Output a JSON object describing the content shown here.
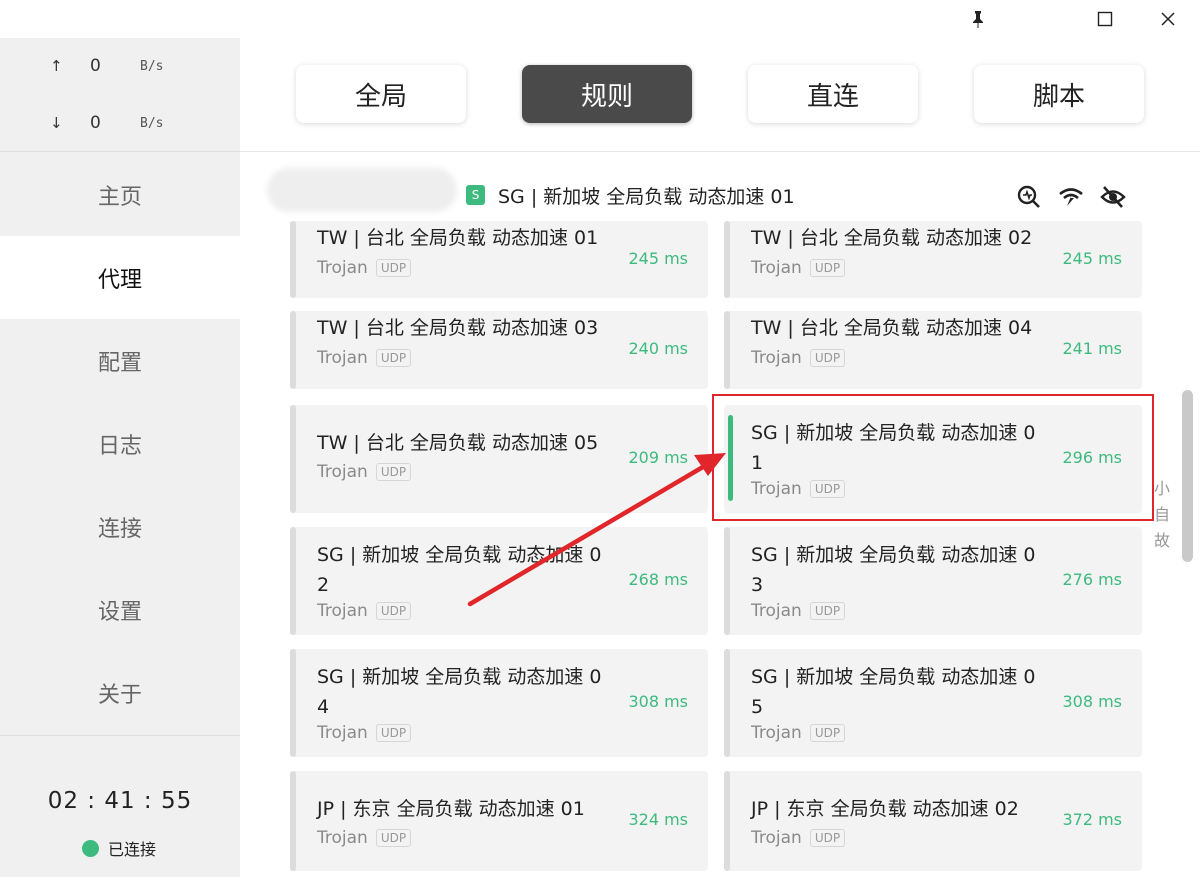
{
  "titlebar": {
    "pin_icon": "pin-icon",
    "maximize_icon": "maximize-icon",
    "close_icon": "close-icon"
  },
  "traffic": {
    "upload": {
      "arrow": "↑",
      "value": "0",
      "unit": "B/s"
    },
    "download": {
      "arrow": "↓",
      "value": "0",
      "unit": "B/s"
    }
  },
  "nav": {
    "home": "主页",
    "proxy": "代理",
    "config": "配置",
    "logs": "日志",
    "connections": "连接",
    "settings": "设置",
    "about": "关于"
  },
  "status": {
    "timer": "02 : 41 : 55",
    "connected": "已连接",
    "connected_color": "#3dba7e"
  },
  "modes": {
    "global": "全局",
    "rule": "规则",
    "direct": "直连",
    "script": "脚本",
    "active": "规则"
  },
  "group": {
    "badge": "S",
    "title": "SG | 新加坡 全局负载 动态加速 01",
    "icons": [
      "search-delay-icon",
      "wifi-test-icon",
      "hide-icon"
    ]
  },
  "proxies": [
    {
      "name": "TW | 台北 全局负载 动态加速 01",
      "protocol": "Trojan",
      "udp": "UDP",
      "delay": "245 ms"
    },
    {
      "name": "TW | 台北 全局负载 动态加速 02",
      "protocol": "Trojan",
      "udp": "UDP",
      "delay": "245 ms"
    },
    {
      "name": "TW | 台北 全局负载 动态加速 03",
      "protocol": "Trojan",
      "udp": "UDP",
      "delay": "240 ms"
    },
    {
      "name": "TW | 台北 全局负载 动态加速 04",
      "protocol": "Trojan",
      "udp": "UDP",
      "delay": "241 ms"
    },
    {
      "name": "TW | 台北 全局负载 动态加速 05",
      "protocol": "Trojan",
      "udp": "UDP",
      "delay": "209 ms"
    },
    {
      "name": "SG | 新加坡 全局负载 动态加速 0\n1",
      "protocol": "Trojan",
      "udp": "UDP",
      "delay": "296 ms",
      "selected": true
    },
    {
      "name": "SG | 新加坡 全局负载 动态加速 0\n2",
      "protocol": "Trojan",
      "udp": "UDP",
      "delay": "268 ms"
    },
    {
      "name": "SG | 新加坡 全局负载 动态加速 0\n3",
      "protocol": "Trojan",
      "udp": "UDP",
      "delay": "276 ms"
    },
    {
      "name": "SG | 新加坡 全局负载 动态加速 0\n4",
      "protocol": "Trojan",
      "udp": "UDP",
      "delay": "308 ms"
    },
    {
      "name": "SG | 新加坡 全局负载 动态加速 0\n5",
      "protocol": "Trojan",
      "udp": "UDP",
      "delay": "308 ms"
    },
    {
      "name": "JP | 东京 全局负载 动态加速 01",
      "protocol": "Trojan",
      "udp": "UDP",
      "delay": "324 ms"
    },
    {
      "name": "JP | 东京 全局负载 动态加速 02",
      "protocol": "Trojan",
      "udp": "UDP",
      "delay": "372 ms"
    }
  ],
  "side_hint": [
    "小",
    "自",
    "故"
  ],
  "annotation": {
    "color": "#e0262a"
  }
}
